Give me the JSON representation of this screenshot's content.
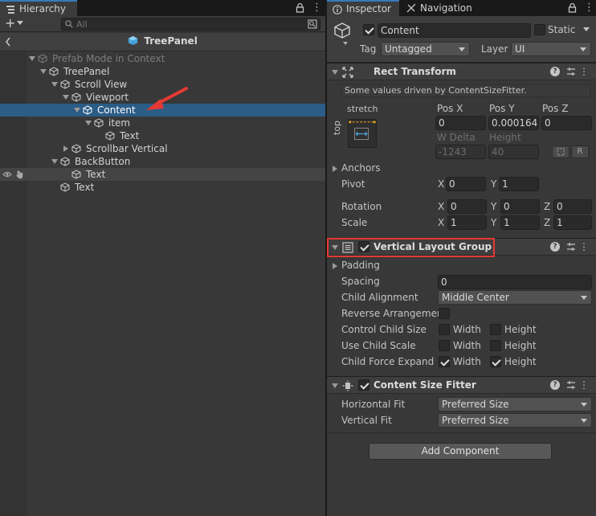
{
  "hierarchy": {
    "tab_title": "Hierarchy",
    "search_placeholder": "All",
    "prefab_title": "TreePanel",
    "rows": [
      {
        "label": "Prefab Mode in Context",
        "depth": 0,
        "state": "dim"
      },
      {
        "label": "TreePanel",
        "depth": 1,
        "state": "normal"
      },
      {
        "label": "Scroll View",
        "depth": 2,
        "state": "normal"
      },
      {
        "label": "Viewport",
        "depth": 3,
        "state": "normal"
      },
      {
        "label": "Content",
        "depth": 4,
        "state": "selected"
      },
      {
        "label": "item",
        "depth": 5,
        "state": "normal"
      },
      {
        "label": "Text",
        "depth": 6,
        "state": "normal"
      },
      {
        "label": "Scrollbar Vertical",
        "depth": 3,
        "state": "collapsed"
      },
      {
        "label": "BackButton",
        "depth": 2,
        "state": "normal"
      },
      {
        "label": "Text",
        "depth": 3,
        "state": "hover"
      },
      {
        "label": "Text",
        "depth": 2,
        "state": "normal"
      }
    ]
  },
  "inspector": {
    "tabs": [
      "Inspector",
      "Navigation"
    ],
    "object_name": "Content",
    "static_label": "Static",
    "tag_label": "Tag",
    "tag_value": "Untagged",
    "layer_label": "Layer",
    "layer_value": "UI",
    "rect_transform": {
      "title": "Rect Transform",
      "driven_notice": "Some values driven by ContentSizeFitter.",
      "stretch_label": "stretch",
      "top_label": "top",
      "pos_x_label": "Pos X",
      "pos_y_label": "Pos Y",
      "pos_z_label": "Pos Z",
      "pos_x": "0",
      "pos_y": "0.000164",
      "pos_z": "0",
      "w_delta_label": "W Delta",
      "height_label": "Height",
      "w_delta": "-1243",
      "height": "40",
      "r_button": "R",
      "anchors_label": "Anchors",
      "pivot_label": "Pivot",
      "pivot_x": "0",
      "pivot_y": "1",
      "rotation_label": "Rotation",
      "rot_x": "0",
      "rot_y": "0",
      "rot_z": "0",
      "scale_label": "Scale",
      "scale_x": "1",
      "scale_y": "1",
      "scale_z": "1",
      "x": "X",
      "y": "Y",
      "z": "Z"
    },
    "vertical_layout_group": {
      "title": "Vertical Layout Group",
      "padding_label": "Padding",
      "spacing_label": "Spacing",
      "spacing": "0",
      "child_alignment_label": "Child Alignment",
      "child_alignment": "Middle Center",
      "reverse_label": "Reverse Arrangement",
      "control_child_size_label": "Control Child Size",
      "use_child_scale_label": "Use Child Scale",
      "child_force_expand_label": "Child Force Expand",
      "width_label": "Width",
      "height_label": "Height"
    },
    "content_size_fitter": {
      "title": "Content Size Fitter",
      "horizontal_fit_label": "Horizontal Fit",
      "horizontal_fit": "Preferred Size",
      "vertical_fit_label": "Vertical Fit",
      "vertical_fit": "Preferred Size"
    },
    "add_component": "Add Component"
  },
  "colors": {
    "selection": "#2c5d87",
    "annotation_red": "#e53935",
    "tab_accent": "#3a79bb"
  }
}
